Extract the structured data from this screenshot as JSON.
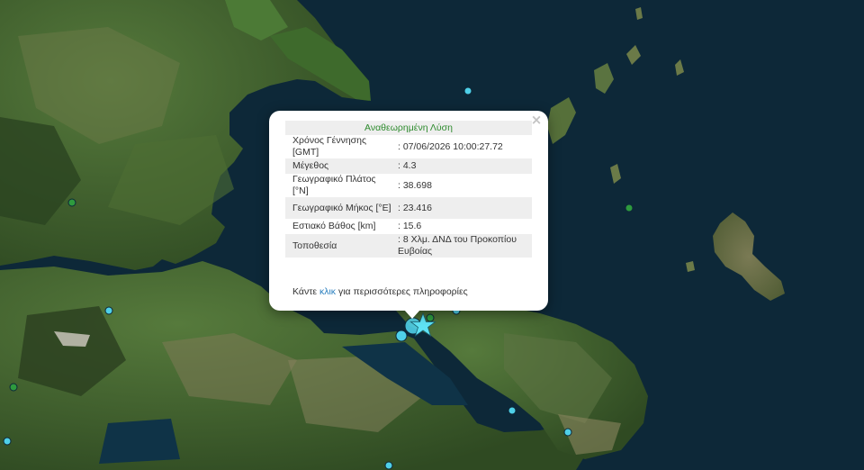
{
  "popup": {
    "title": "Αναθεωρημένη Λύση",
    "close_symbol": "×",
    "rows": [
      {
        "label": "Χρόνος Γέννησης [GMT]",
        "value": ": 07/06/2026 10:00:27.72"
      },
      {
        "label": "Μέγεθος",
        "value": ": 4.3"
      },
      {
        "label": "Γεωγραφικό Πλάτος [°N]",
        "value": ": 38.698"
      },
      {
        "label": "Γεωγραφικό Μήκος [°E]",
        "value": ": 23.416"
      },
      {
        "label": "Εστιακό Βάθος [km]",
        "value": ": 15.6"
      },
      {
        "label": "Τοποθεσία",
        "value": ": 8 Χλμ. ΔΝΔ του Προκοπίου Ευβοίας"
      }
    ],
    "footer_prefix": "Κάντε ",
    "footer_link": "κλικ",
    "footer_suffix": " για περισσότερες πληροφορίες"
  },
  "colors": {
    "sea": "#0d2838",
    "land_green": "#3c5a2a",
    "popup_title": "#2e8b2e",
    "link": "#2a7fbf",
    "quake_recent": "#4fd0e8",
    "quake_old": "#2e9a3e",
    "star_marker": "#5fe3f5"
  },
  "markers": {
    "main_event_icon": "star-icon",
    "other_events_icon": "circle-icon"
  }
}
